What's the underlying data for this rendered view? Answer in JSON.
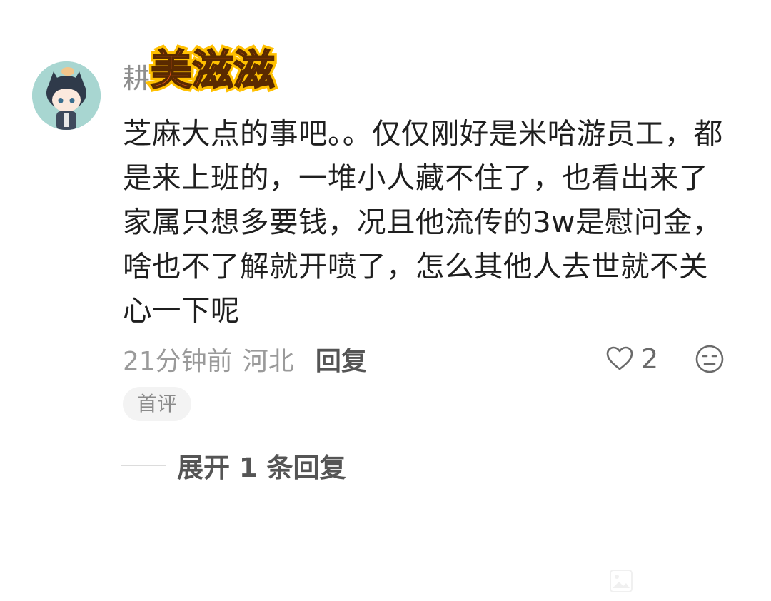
{
  "comment": {
    "username": "耕",
    "sticker_text": "美滋滋",
    "text": "芝麻大点的事吧。。仅仅刚好是米哈游员工，都是来上班的，一堆小人藏不住了，也看出来了家属只想多要钱，况且他流传的3w是慰问金，啥也不了解就开喷了，怎么其他人去世就不关心一下呢",
    "time": "21分钟前",
    "location": "河北",
    "reply_label": "回复",
    "like_count": "2",
    "badge": "首评",
    "expand_label": "展开 1 条回复"
  },
  "icons": {
    "avatar": "avatar-anime-catboy",
    "like": "heart-outline-icon",
    "dislike": "meh-face-icon",
    "watermark": "image-watermark-icon"
  },
  "colors": {
    "text_primary": "#1f1f1f",
    "text_secondary": "#9a9a9a",
    "badge_bg": "#f3f3f3",
    "sticker_fill": "#ff5a1f",
    "sticker_outline": "#ffc000"
  }
}
